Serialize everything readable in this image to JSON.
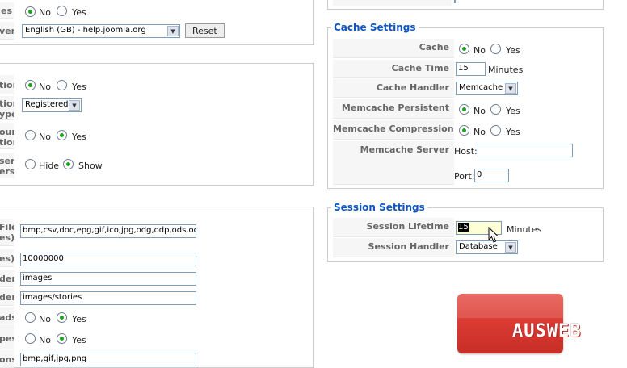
{
  "left_top": {
    "row1_label": "es",
    "row1_options": [
      "No",
      "Yes"
    ],
    "row2_label": "ver",
    "row2_select": "English (GB) - help.joomla.org",
    "reset_label": "Reset"
  },
  "left_mid": {
    "rows": [
      {
        "label": "tion",
        "options": [
          "No",
          "Yes"
        ]
      },
      {
        "label_lines": [
          "tion",
          "ype"
        ],
        "select": "Registered"
      },
      {
        "label_lines": [
          "ount",
          "tion"
        ],
        "options": [
          "No",
          "Yes"
        ]
      },
      {
        "label_lines": [
          "ser",
          "ers"
        ],
        "options": [
          "Hide",
          "Show"
        ]
      }
    ]
  },
  "left_bottom": {
    "row1_label_lines": [
      "File",
      "es)"
    ],
    "row1_value": "bmp,csv,doc,epg,gif,ico,jpg,odg,odp,ods,odt,p",
    "row2_label": "es)",
    "row2_value": "10000000",
    "row3_label": "der",
    "row3_value": "images",
    "row4_label": "der",
    "row4_value": "images/stories",
    "row5_label": "ads",
    "row5_options": [
      "No",
      "Yes"
    ],
    "row6_label": "pes",
    "row6_options": [
      "No",
      "Yes"
    ],
    "row7_label": "ons",
    "row7_value": "bmp,gif,jpg,png"
  },
  "cache": {
    "legend": "Cache Settings",
    "cache_label": "Cache",
    "cache_options": [
      "No",
      "Yes"
    ],
    "cache_time_label": "Cache Time",
    "cache_time_value": "15",
    "cache_time_unit": "Minutes",
    "cache_handler_label": "Cache Handler",
    "cache_handler_value": "Memcache",
    "persistent_label": "Memcache Persistent",
    "persistent_options": [
      "No",
      "Yes"
    ],
    "compression_label": "Memcache Compression",
    "compression_options": [
      "No",
      "Yes"
    ],
    "server_label": "Memcache Server",
    "host_label": "Host:",
    "host_value": "",
    "port_label": "Port:",
    "port_value": "0"
  },
  "session": {
    "legend": "Session Settings",
    "lifetime_label": "Session Lifetime",
    "lifetime_value": "15",
    "lifetime_unit": "Minutes",
    "handler_label": "Session Handler",
    "handler_value": "Database"
  },
  "watermark": {
    "text": "AUSWEB",
    "color": "#d93a32"
  }
}
